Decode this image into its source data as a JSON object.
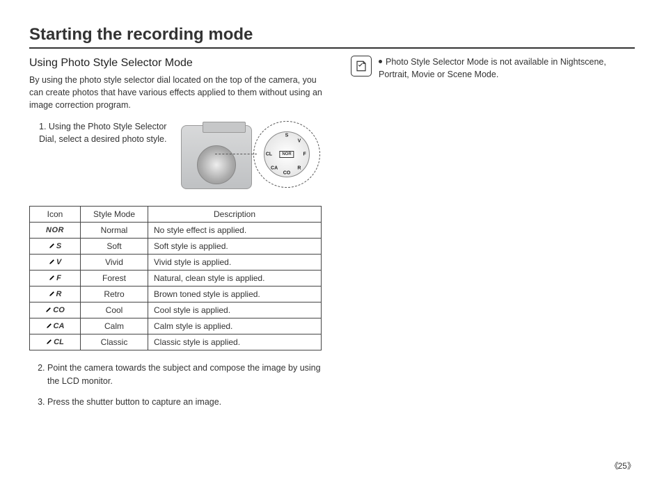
{
  "title": "Starting the recording mode",
  "subtitle": "Using Photo Style Selector Mode",
  "intro": "By using the photo style selector dial located on the top of the camera, you can create photos that have various effects applied to them without using an image correction program.",
  "step1": "1. Using the Photo Style Selector Dial, select a desired photo style.",
  "dial_center": "NOR",
  "dial_labels": [
    "S",
    "V",
    "F",
    "R",
    "CO",
    "CA",
    "CL"
  ],
  "table": {
    "headers": {
      "icon": "Icon",
      "mode": "Style Mode",
      "desc": "Description"
    },
    "rows": [
      {
        "icon": "NOR",
        "brush": false,
        "mode": "Normal",
        "desc": "No style effect is applied."
      },
      {
        "icon": "S",
        "brush": true,
        "mode": "Soft",
        "desc": "Soft style is applied."
      },
      {
        "icon": "V",
        "brush": true,
        "mode": "Vivid",
        "desc": "Vivid style is applied."
      },
      {
        "icon": "F",
        "brush": true,
        "mode": "Forest",
        "desc": "Natural, clean style is applied."
      },
      {
        "icon": "R",
        "brush": true,
        "mode": "Retro",
        "desc": "Brown toned style is applied."
      },
      {
        "icon": "CO",
        "brush": true,
        "mode": "Cool",
        "desc": "Cool style is applied."
      },
      {
        "icon": "CA",
        "brush": true,
        "mode": "Calm",
        "desc": "Calm style is applied."
      },
      {
        "icon": "CL",
        "brush": true,
        "mode": "Classic",
        "desc": "Classic style is applied."
      }
    ]
  },
  "step2": "Point the camera towards the subject and compose the image by using the LCD monitor.",
  "step3": "Press the shutter button to capture an image.",
  "note": "Photo Style Selector Mode is not available in Nightscene, Portrait, Movie or Scene Mode.",
  "page_number": "25"
}
